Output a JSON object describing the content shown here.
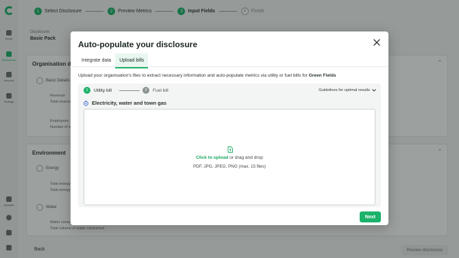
{
  "app": {
    "sidebar": {
      "items": [
        {
          "label": "Home",
          "icon": "home-icon"
        },
        {
          "label": "Disclosures",
          "icon": "document-icon"
        },
        {
          "label": "Account",
          "icon": "account-icon"
        },
        {
          "label": "Settings",
          "icon": "gear-icon"
        },
        {
          "label": "Uploads",
          "icon": "upload-icon"
        }
      ]
    },
    "stepper": {
      "steps": [
        {
          "num": "1",
          "label": "Select Disclosure"
        },
        {
          "num": "2",
          "label": "Preview Metrics"
        },
        {
          "num": "3",
          "label": "Input Fields"
        },
        {
          "num": "4",
          "label": "Finish"
        }
      ]
    },
    "header": {
      "subtitle": "Disclosure",
      "title": "Basic Pack"
    },
    "sections": [
      {
        "title": "Organisation details",
        "sub": "Basic Details",
        "rows": [
          "Revenue",
          "Total revenue",
          "Employees",
          "Number of employees"
        ]
      },
      {
        "title": "Environment",
        "subs": [
          "Energy",
          "Water"
        ],
        "rows": [
          "Total energy",
          "Total energy consumption",
          "Water consumption",
          "Total volume of water consumed"
        ]
      }
    ],
    "back_label": "Back",
    "review_label": "Review disclosure"
  },
  "modal": {
    "title": "Auto-populate your disclosure",
    "tabs": [
      {
        "label": "Integrate data",
        "active": false
      },
      {
        "label": "Upload bills",
        "active": true
      }
    ],
    "description_prefix": "Upload your organisation's files to extract necessary information and auto-populate metrics via utility or fuel bills for ",
    "organisation": "Green Fields",
    "upload_steps": [
      {
        "num": "1",
        "label": "Utility bill",
        "active": true
      },
      {
        "num": "2",
        "label": "Fuel bill",
        "active": false
      }
    ],
    "guidelines_label": "Guidelines for optimal results",
    "section_title": "Electricity, water and town gas",
    "dropzone": {
      "link_text": "Click to upload",
      "rest_text": " or drag and drop",
      "formats": "PDF, JPG, JPEG, PNG (max. 15 files)"
    },
    "next_label": "Next"
  },
  "colors": {
    "accent": "#1cb26b",
    "overlay": "rgba(20,28,24,0.42)"
  }
}
